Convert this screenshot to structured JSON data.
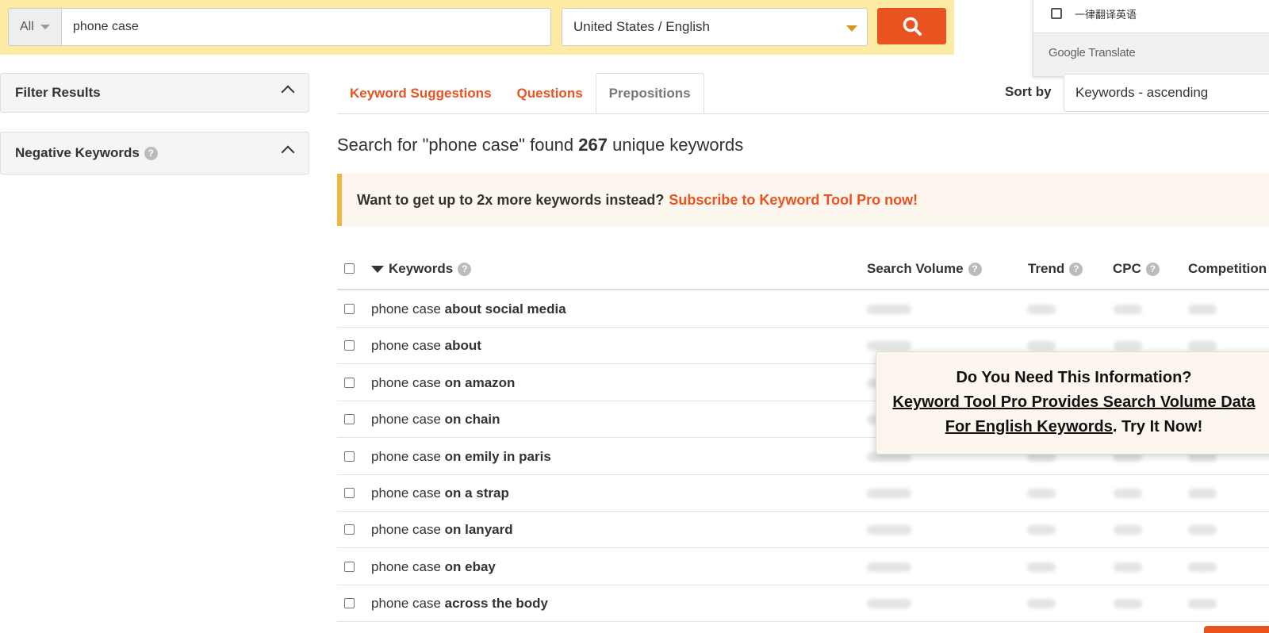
{
  "search": {
    "scope": "All",
    "query": "phone case",
    "locale": "United States / English"
  },
  "translate_popup": {
    "option_label": "一律翻译英语",
    "brand_google": "Google",
    "brand_translate": "Translate"
  },
  "sidebar": {
    "filter_results": "Filter Results",
    "negative_keywords": "Negative Keywords"
  },
  "tabs": [
    {
      "label": "Keyword Suggestions",
      "active": false
    },
    {
      "label": "Questions",
      "active": false
    },
    {
      "label": "Prepositions",
      "active": true
    }
  ],
  "sort": {
    "label": "Sort by",
    "value": "Keywords - ascending"
  },
  "summary": {
    "prefix": "Search for \"phone case\" found",
    "count": "267",
    "suffix": "unique keywords"
  },
  "promo": {
    "text": "Want to get up to 2x more keywords instead?",
    "link": "Subscribe to Keyword Tool Pro now!"
  },
  "table": {
    "columns": {
      "keywords": "Keywords",
      "search_volume": "Search Volume",
      "trend": "Trend",
      "cpc": "CPC",
      "competition": "Competition"
    },
    "rows": [
      {
        "base": "phone case",
        "suffix": "about social media"
      },
      {
        "base": "phone case",
        "suffix": "about"
      },
      {
        "base": "phone case",
        "suffix": "on amazon"
      },
      {
        "base": "phone case",
        "suffix": "on chain"
      },
      {
        "base": "phone case",
        "suffix": "on emily in paris"
      },
      {
        "base": "phone case",
        "suffix": "on a strap"
      },
      {
        "base": "phone case",
        "suffix": "on lanyard"
      },
      {
        "base": "phone case",
        "suffix": "on ebay"
      },
      {
        "base": "phone case",
        "suffix": "across the body"
      }
    ]
  },
  "overlay": {
    "line1": "Do You Need This Information?",
    "link": "Keyword Tool Pro Provides Search Volume Data For English Keywords",
    "tail": ". Try It Now!"
  },
  "colors": {
    "accent": "#e8531f",
    "search_bar_bg": "#fdeaa3",
    "promo_border": "#f0b840"
  }
}
